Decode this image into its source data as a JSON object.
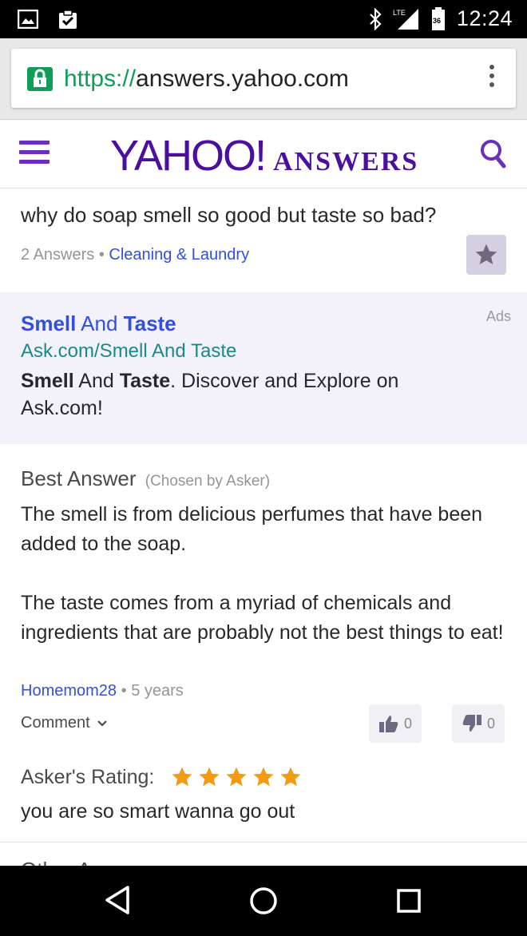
{
  "status_bar": {
    "time": "12:24",
    "network": "LTE",
    "battery": "36"
  },
  "browser": {
    "url_scheme": "https://",
    "url_host": "answers.yahoo.com"
  },
  "header": {
    "logo_main": "YAHOO!",
    "logo_sub": "ANSWERS"
  },
  "question": {
    "title": "why do soap smell so good but taste so bad?",
    "answers_count": "2 Answers",
    "separator": "•",
    "category": "Cleaning & Laundry"
  },
  "ad": {
    "label": "Ads",
    "title_bold1": "Smell",
    "title_mid": " And ",
    "title_bold2": "Taste",
    "url": "Ask.com/Smell And Taste",
    "desc_bold1": "Smell",
    "desc_mid": " And ",
    "desc_bold2": "Taste",
    "desc_rest": ". Discover and Explore on Ask.com!"
  },
  "best_answer": {
    "heading": "Best Answer",
    "chosen": "(Chosen by Asker)",
    "paragraph1": "The smell is from delicious perfumes that have been added to the soap.",
    "paragraph2": "The taste comes from a myriad of chemicals and ingredients that are probably not the best things to eat!",
    "user": "Homemom28",
    "separator": "•",
    "age": "5 years",
    "comment_label": "Comment",
    "thumbs_up": "0",
    "thumbs_down": "0"
  },
  "rating": {
    "label": "Asker's Rating:",
    "stars": 5,
    "star_color": "#f39c12",
    "comment": "you are so smart wanna go out"
  },
  "other_answers": {
    "label": "Other Answers"
  },
  "colors": {
    "brand": "#4b0fa0",
    "link": "#324fe1",
    "secure": "#0f9d58"
  }
}
